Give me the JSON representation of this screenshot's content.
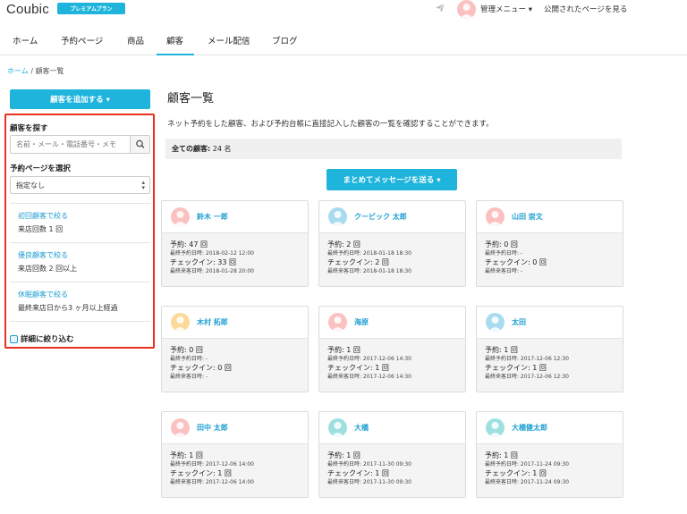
{
  "header": {
    "logo": "Coubic",
    "plan_badge": "プレミアムプラン",
    "admin_menu": "管理メニュー ▾",
    "public_link": "公開されたページを見る"
  },
  "nav": {
    "items": [
      "ホーム",
      "予約ページ",
      "商品",
      "顧客",
      "メール配信",
      "ブログ"
    ],
    "active": "顧客"
  },
  "breadcrumb": {
    "home": "ホーム",
    "sep": "/",
    "current": "顧客一覧"
  },
  "sidebar": {
    "add_button": "顧客を追加する ▾",
    "search_title": "顧客を探す",
    "search_placeholder": "名前・メール・電話番号・メモ",
    "page_select_title": "予約ページを選択",
    "page_select_value": "指定なし",
    "filters": [
      {
        "link": "初回顧客で絞る",
        "desc": "来店回数 1 回"
      },
      {
        "link": "優良顧客で絞る",
        "desc": "来店回数 2 回以上"
      },
      {
        "link": "休眠顧客で絞る",
        "desc": "最終来店日から3 ヶ月以上経過"
      }
    ],
    "detail_filter": "詳細に絞り込む"
  },
  "main": {
    "title": "顧客一覧",
    "description": "ネット予約をした顧客、および予約台帳に直接記入した顧客の一覧を確認することができます。",
    "total_label": "全ての顧客:",
    "total_value": "24 名",
    "bulk_button": "まとめてメッセージを送る ▾"
  },
  "customers": [
    {
      "name": "鈴木 一郎",
      "avatar_color": "#fbc1c1",
      "reservations": "予約: 47 回",
      "last_reservation": "最終予約日時: 2018-02-12 12:00",
      "checkins": "チェックイン: 33 回",
      "last_visit": "最終来客日時: 2018-01-28 20:00"
    },
    {
      "name": "クービック 太郎",
      "avatar_color": "#a8daf0",
      "reservations": "予約: 2 回",
      "last_reservation": "最終予約日時: 2018-01-18 18:30",
      "checkins": "チェックイン: 2 回",
      "last_visit": "最終来客日時: 2018-01-18 18:30"
    },
    {
      "name": "山田 崇文",
      "avatar_color": "#fbc1c1",
      "reservations": "予約: 0 回",
      "last_reservation": "最終予約日時: -",
      "checkins": "チェックイン: 0 回",
      "last_visit": "最終来客日時: -"
    },
    {
      "name": "木村 拓郎",
      "avatar_color": "#fcd99a",
      "reservations": "予約: 0 回",
      "last_reservation": "最終予約日時: -",
      "checkins": "チェックイン: 0 回",
      "last_visit": "最終来客日時: -"
    },
    {
      "name": "海原",
      "avatar_color": "#fbc1c1",
      "reservations": "予約: 1 回",
      "last_reservation": "最終予約日時: 2017-12-06 14:30",
      "checkins": "チェックイン: 1 回",
      "last_visit": "最終来客日時: 2017-12-06 14:30"
    },
    {
      "name": "太田",
      "avatar_color": "#a8daf0",
      "reservations": "予約: 1 回",
      "last_reservation": "最終予約日時: 2017-12-06 12:30",
      "checkins": "チェックイン: 1 回",
      "last_visit": "最終来客日時: 2017-12-06 12:30"
    },
    {
      "name": "田中 太郎",
      "avatar_color": "#fbc1c1",
      "reservations": "予約: 1 回",
      "last_reservation": "最終予約日時: 2017-12-06 14:00",
      "checkins": "チェックイン: 1 回",
      "last_visit": "最終来客日時: 2017-12-06 14:00"
    },
    {
      "name": "大橋",
      "avatar_color": "#9ee0e0",
      "reservations": "予約: 1 回",
      "last_reservation": "最終予約日時: 2017-11-30 09:30",
      "checkins": "チェックイン: 1 回",
      "last_visit": "最終来客日時: 2017-11-30 09:30"
    },
    {
      "name": "大橋健太郎",
      "avatar_color": "#9ee0e0",
      "reservations": "予約: 1 回",
      "last_reservation": "最終予約日時: 2017-11-24 09:30",
      "checkins": "チェックイン: 1 回",
      "last_visit": "最終来客日時: 2017-11-24 09:30"
    }
  ]
}
